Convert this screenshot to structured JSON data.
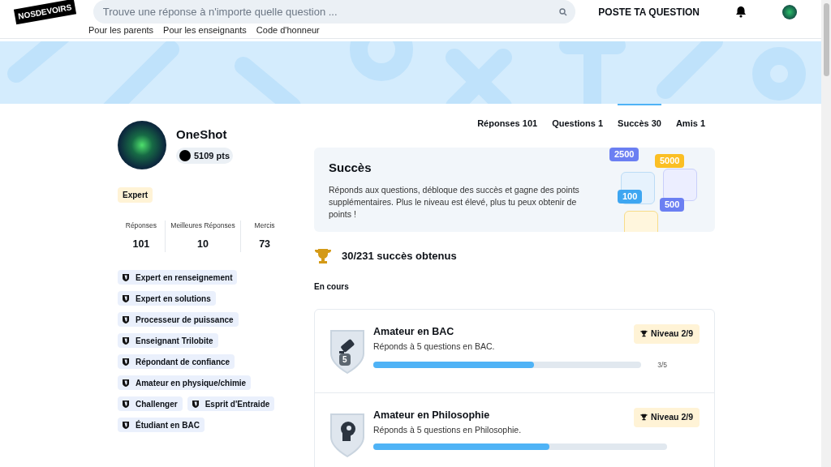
{
  "header": {
    "logo": "NOSDEVOIRS",
    "search": {
      "placeholder": "Trouve une réponse à n'importe quelle question ..."
    },
    "ask_button": "POSTE TA QUESTION"
  },
  "nav_links": [
    "Pour les parents",
    "Pour les enseignants",
    "Code d'honneur"
  ],
  "profile": {
    "name": "OneShot",
    "points": "5109 pts",
    "rank": "Expert",
    "stats": [
      {
        "label": "Réponses",
        "value": "101"
      },
      {
        "label": "Meilleures Réponses",
        "value": "10"
      },
      {
        "label": "Mercis",
        "value": "73"
      }
    ],
    "badges": [
      "Expert en renseignement",
      "Expert en solutions",
      "Processeur de puissance",
      "Enseignant Trilobite",
      "Répondant de confiance",
      "Amateur en physique/chimie",
      "Challenger",
      "Esprit d'Entraide",
      "Étudiant en BAC"
    ]
  },
  "tabs": [
    {
      "label": "Réponses 101",
      "selected": false
    },
    {
      "label": "Questions 1",
      "selected": false
    },
    {
      "label": "Succès 30",
      "selected": true
    },
    {
      "label": "Amis 1",
      "selected": false
    }
  ],
  "intro": {
    "title": "Succès",
    "text": "Réponds aux questions, débloque des succès et gagne des points supplémentaires. Plus le niveau est élevé, plus tu peux obtenir de points !",
    "tiles": [
      "2500",
      "5000",
      "100",
      "500"
    ]
  },
  "summary": "30/231 succès obtenus",
  "section_title": "En cours",
  "achievements": [
    {
      "title": "Amateur en BAC",
      "description": "Réponds à 5 questions en BAC.",
      "level_badge": "Niveau 2/9",
      "kind": "pen",
      "badge_number": "5",
      "level": 0.6,
      "reading": "3/5"
    },
    {
      "title": "Amateur en Philosophie",
      "description": "Réponds à 5 questions en Philosophie.",
      "level_badge": "Niveau 2/9",
      "kind": "head",
      "level": 0.6
    }
  ]
}
